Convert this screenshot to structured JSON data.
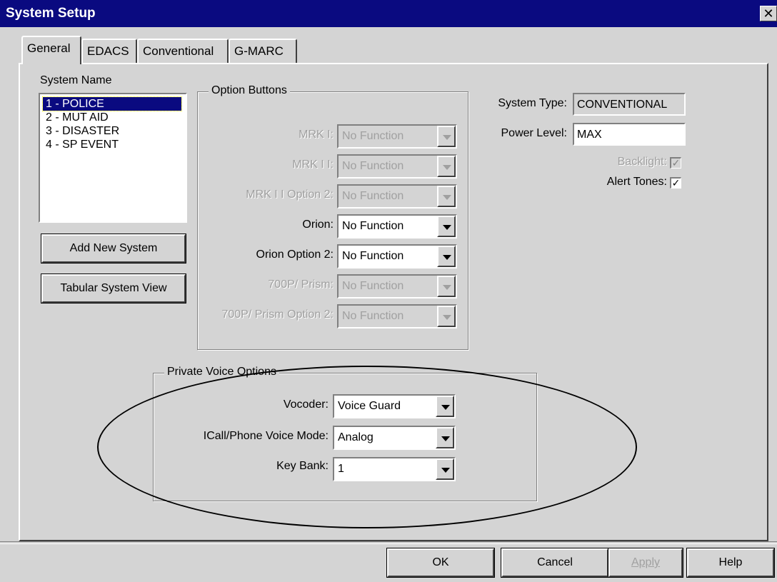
{
  "window": {
    "title": "System Setup",
    "close_label": "✕"
  },
  "tabs": [
    {
      "label": "General"
    },
    {
      "label": "EDACS"
    },
    {
      "label": "Conventional"
    },
    {
      "label": "G-MARC"
    }
  ],
  "system_name": {
    "label": "System Name",
    "items": [
      "1 - POLICE",
      "2 - MUT AID",
      "3 - DISASTER",
      "4 - SP EVENT"
    ],
    "selected_index": 0
  },
  "buttons": {
    "add_new_system": "Add New System",
    "tabular_view": "Tabular System View",
    "ok": "OK",
    "cancel": "Cancel",
    "apply": "Apply",
    "help": "Help"
  },
  "option_buttons": {
    "title": "Option Buttons",
    "rows": [
      {
        "label": "MRK I:",
        "value": "No Function",
        "enabled": false
      },
      {
        "label": "MRK I I:",
        "value": "No Function",
        "enabled": false
      },
      {
        "label": "MRK I I Option 2:",
        "value": "No Function",
        "enabled": false
      },
      {
        "label": "Orion:",
        "value": "No Function",
        "enabled": true
      },
      {
        "label": "Orion Option 2:",
        "value": "No Function",
        "enabled": true
      },
      {
        "label": "700P/ Prism:",
        "value": "No Function",
        "enabled": false
      },
      {
        "label": "700P/ Prism Option 2:",
        "value": "No Function",
        "enabled": false
      }
    ]
  },
  "system_info": {
    "system_type_label": "System Type:",
    "system_type_value": "CONVENTIONAL",
    "power_level_label": "Power Level:",
    "power_level_value": "MAX",
    "backlight_label": "Backlight:",
    "backlight_checked": true,
    "backlight_enabled": false,
    "alert_tones_label": "Alert Tones:",
    "alert_tones_checked": true,
    "check_mark": "✓"
  },
  "private_voice": {
    "title": "Private Voice Options",
    "vocoder_label": "Vocoder:",
    "vocoder_value": "Voice Guard",
    "icall_label": "ICall/Phone Voice Mode:",
    "icall_value": "Analog",
    "keybank_label": "Key Bank:",
    "keybank_value": "1"
  }
}
